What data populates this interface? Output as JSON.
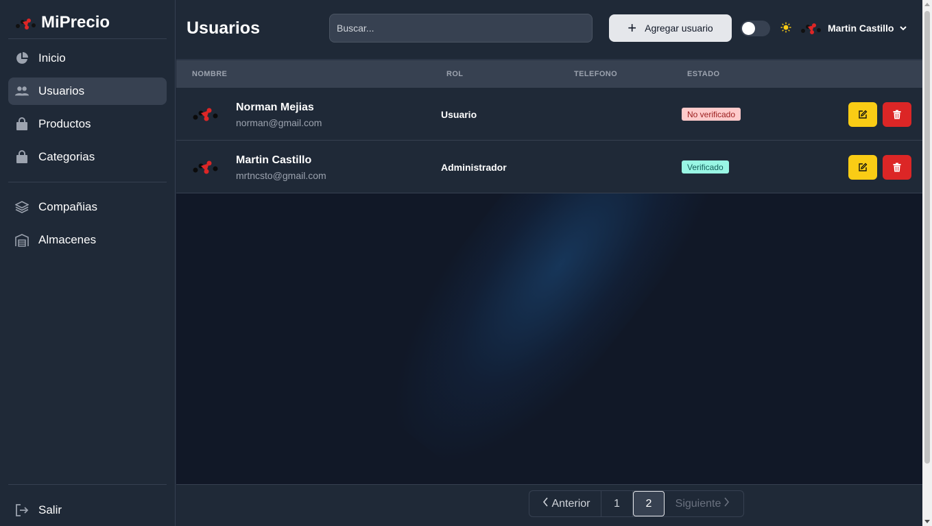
{
  "brand": {
    "name": "MiPrecio",
    "logo_icon": "miprecio-logo-icon"
  },
  "sidebar": {
    "items": [
      {
        "label": "Inicio",
        "icon": "pie-chart-icon",
        "active": false
      },
      {
        "label": "Usuarios",
        "icon": "users-icon",
        "active": true
      },
      {
        "label": "Productos",
        "icon": "shopping-bag-icon",
        "active": false
      },
      {
        "label": "Categorias",
        "icon": "shopping-bag-icon",
        "active": false
      }
    ],
    "items2": [
      {
        "label": "Compañias",
        "icon": "layers-icon",
        "active": false
      },
      {
        "label": "Almacenes",
        "icon": "warehouse-icon",
        "active": false
      }
    ],
    "logout": {
      "label": "Salir",
      "icon": "logout-icon"
    }
  },
  "header": {
    "title": "Usuarios",
    "search_placeholder": "Buscar...",
    "add_button_label": "Agregar usuario",
    "user_name": "Martin Castillo"
  },
  "table": {
    "columns": [
      "NOMBRE",
      "ROL",
      "TELEFONO",
      "ESTADO"
    ],
    "rows": [
      {
        "name": "Norman Mejias",
        "email": "norman@gmail.com",
        "role": "Usuario",
        "phone": "",
        "status": "No verificado",
        "status_color": "#fecaca"
      },
      {
        "name": "Martin Castillo",
        "email": "mrtncsto@gmail.com",
        "role": "Administrador",
        "phone": "",
        "status": "Verificado",
        "status_color": "#99f6e4"
      }
    ]
  },
  "pagination": {
    "prev_label": "Anterior",
    "pages": [
      "1",
      "2"
    ],
    "current_page": "2",
    "next_label": "Siguiente"
  },
  "colors": {
    "background": "#111827",
    "panel": "#1f2937",
    "edit": "#facc15",
    "delete": "#dc2626",
    "brand_red": "#dc2626"
  }
}
